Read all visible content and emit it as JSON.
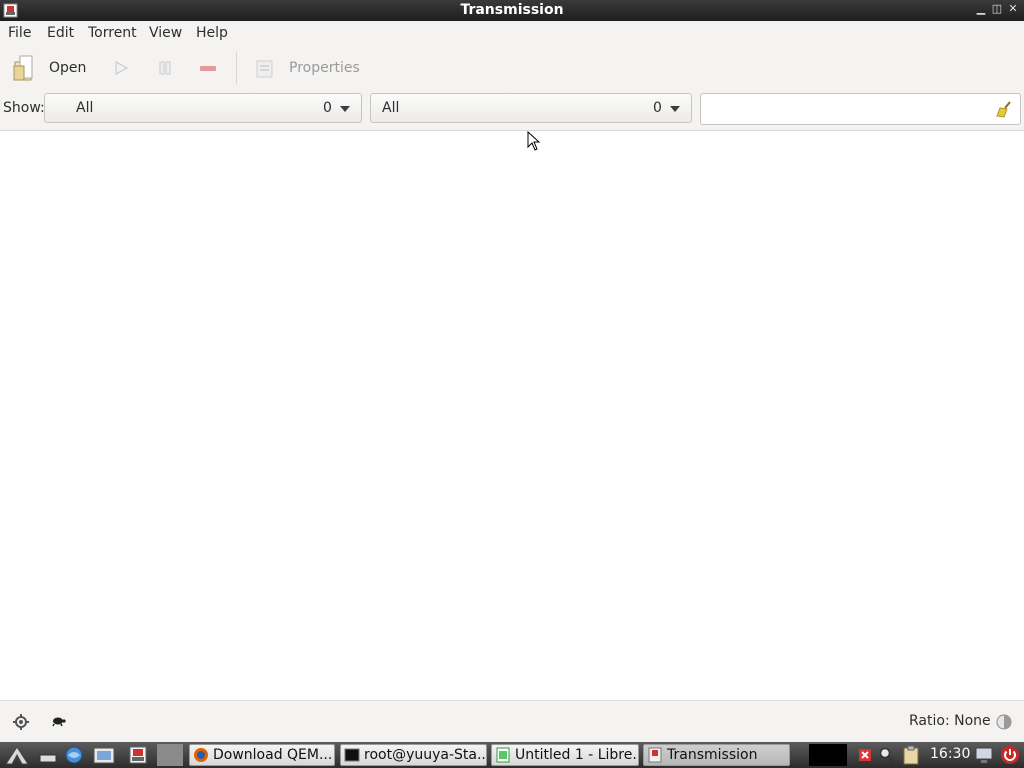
{
  "window": {
    "title": "Transmission"
  },
  "menu": {
    "file": "File",
    "edit": "Edit",
    "torrent": "Torrent",
    "view": "View",
    "help": "Help"
  },
  "toolbar": {
    "open_label": "Open",
    "properties_label": "Properties"
  },
  "filter": {
    "show_label": "Show:",
    "activity": {
      "value": "All",
      "count": "0"
    },
    "tracker": {
      "value": "All",
      "count": "0"
    },
    "search_value": ""
  },
  "status": {
    "ratio": "Ratio: None"
  },
  "taskbar": {
    "tasks": [
      {
        "label": "Download QEM..."
      },
      {
        "label": "root@yuuya-Sta..."
      },
      {
        "label": "Untitled 1 - Libre..."
      },
      {
        "label": "Transmission"
      }
    ],
    "clock": "16:30"
  },
  "icons": {
    "app": "transmission-icon",
    "open": "open-file-icon",
    "start": "play-icon",
    "pause": "pause-icon",
    "remove": "remove-icon",
    "properties": "properties-icon",
    "clear": "clear-broom-icon",
    "prefs": "gear-icon",
    "turtle": "turtle-icon",
    "ratio": "ratio-icon"
  }
}
